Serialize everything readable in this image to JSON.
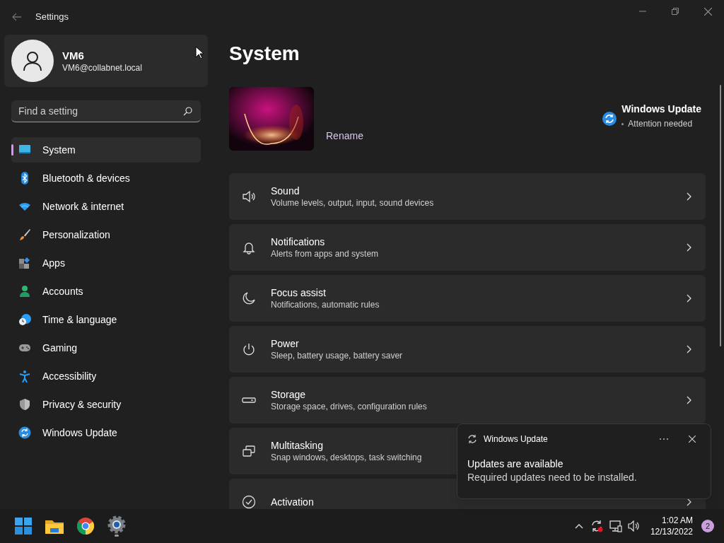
{
  "window": {
    "title": "Settings"
  },
  "account": {
    "name": "VM6",
    "email": "VM6@collabnet.local"
  },
  "search": {
    "placeholder": "Find a setting"
  },
  "sidebar": {
    "items": [
      {
        "label": "System",
        "selected": true
      },
      {
        "label": "Bluetooth & devices",
        "selected": false
      },
      {
        "label": "Network & internet",
        "selected": false
      },
      {
        "label": "Personalization",
        "selected": false
      },
      {
        "label": "Apps",
        "selected": false
      },
      {
        "label": "Accounts",
        "selected": false
      },
      {
        "label": "Time & language",
        "selected": false
      },
      {
        "label": "Gaming",
        "selected": false
      },
      {
        "label": "Accessibility",
        "selected": false
      },
      {
        "label": "Privacy & security",
        "selected": false
      },
      {
        "label": "Windows Update",
        "selected": false
      }
    ]
  },
  "page": {
    "title": "System",
    "rename": "Rename",
    "update": {
      "title": "Windows Update",
      "status": "Attention needed"
    }
  },
  "settings": [
    {
      "title": "Sound",
      "description": "Volume levels, output, input, sound devices"
    },
    {
      "title": "Notifications",
      "description": "Alerts from apps and system"
    },
    {
      "title": "Focus assist",
      "description": "Notifications, automatic rules"
    },
    {
      "title": "Power",
      "description": "Sleep, battery usage, battery saver"
    },
    {
      "title": "Storage",
      "description": "Storage space, drives, configuration rules"
    },
    {
      "title": "Multitasking",
      "description": "Snap windows, desktops, task switching"
    },
    {
      "title": "Activation"
    }
  ],
  "toast": {
    "app": "Windows Update",
    "title": "Updates are available",
    "body": "Required updates need to be installed."
  },
  "taskbar": {
    "time": "1:02 AM",
    "date": "12/13/2022",
    "badge": "2"
  }
}
